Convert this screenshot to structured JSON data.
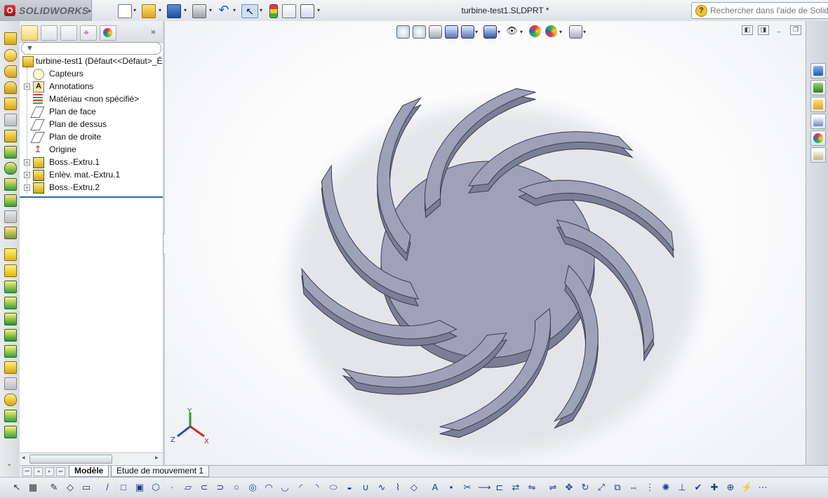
{
  "app": {
    "name": "SOLIDWORKS",
    "document_title": "turbine-test1.SLDPRT *",
    "help_search_placeholder": "Rechercher dans l'aide de SolidWorks"
  },
  "feature_tree": {
    "root": "turbine-test1  (Défaut<<Défaut>_É",
    "items": [
      {
        "label": "Capteurs",
        "icon": "sensor-icon",
        "expandable": false
      },
      {
        "label": "Annotations",
        "icon": "annotations-icon",
        "expandable": true
      },
      {
        "label": "Matériau <non spécifié>",
        "icon": "material-icon",
        "expandable": false
      },
      {
        "label": "Plan de face",
        "icon": "plane-icon",
        "expandable": false
      },
      {
        "label": "Plan de dessus",
        "icon": "plane-icon",
        "expandable": false
      },
      {
        "label": "Plan de droite",
        "icon": "plane-icon",
        "expandable": false
      },
      {
        "label": "Origine",
        "icon": "origin-icon",
        "expandable": false
      },
      {
        "label": "Boss.-Extru.1",
        "icon": "boss-extrude-icon",
        "expandable": true
      },
      {
        "label": "Enlèv. mat.-Extru.1",
        "icon": "cut-extrude-icon",
        "expandable": true
      },
      {
        "label": "Boss.-Extru.2",
        "icon": "boss-extrude-icon",
        "expandable": true
      }
    ]
  },
  "triad": {
    "x": "X",
    "y": "Y",
    "z": "Z"
  },
  "bottom_tabs": [
    "Modèle",
    "Etude de mouvement 1"
  ],
  "colors": {
    "model_face": "#9ea2b8",
    "model_side": "#7a7e96",
    "edge": "#3a3d4e",
    "accent": "#2f63b2"
  }
}
